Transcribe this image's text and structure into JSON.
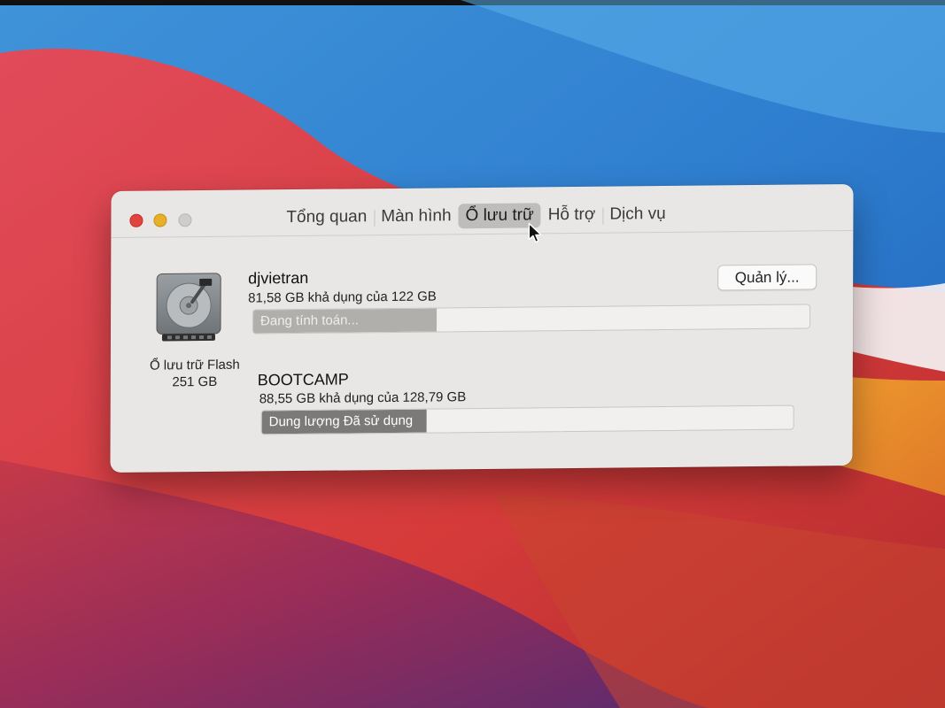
{
  "tabs": [
    {
      "label": "Tổng quan",
      "active": false
    },
    {
      "label": "Màn hình",
      "active": false
    },
    {
      "label": "Ổ lưu trữ",
      "active": true
    },
    {
      "label": "Hỗ trợ",
      "active": false
    },
    {
      "label": "Dịch vụ",
      "active": false
    }
  ],
  "disk": {
    "name": "Ổ lưu trữ Flash",
    "size": "251 GB",
    "icon": "hard-drive-icon"
  },
  "volumes": [
    {
      "name": "djvietran",
      "info": "81,58 GB khả dụng của 122 GB",
      "bar_label": "Đang tính toán...",
      "used_fraction": 0.33
    },
    {
      "name": "BOOTCAMP",
      "info": "88,55 GB khả dụng của 128,79 GB",
      "bar_label": "Dung lượng Đã sử dụng",
      "used_fraction": 0.31
    }
  ],
  "manage_button": "Quản lý...",
  "colors": {
    "close": "#e0443e",
    "minimize": "#e6b02a",
    "zoom": "#cfcdcb",
    "window": "#e9e7e5"
  }
}
